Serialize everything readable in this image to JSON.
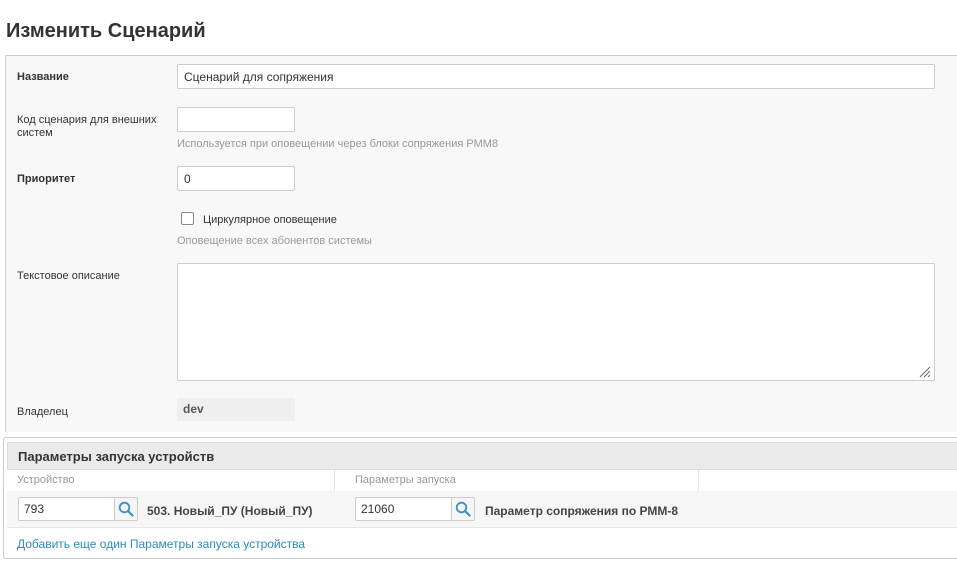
{
  "page_title": "Изменить Сценарий",
  "form": {
    "name": {
      "label": "Название",
      "value": "Сценарий для сопряжения"
    },
    "external_code": {
      "label": "Код сценария для внешних систем",
      "value": "",
      "help": "Используется при оповещении через блоки сопряжения РММ8"
    },
    "priority": {
      "label": "Приоритет",
      "value": "0"
    },
    "circular": {
      "checkbox_label": "Циркулярное оповещение",
      "checked": false,
      "help": "Оповещение всех абонентов системы"
    },
    "description": {
      "label": "Текстовое описание",
      "value": ""
    },
    "owner": {
      "label": "Владелец",
      "value": "dev"
    }
  },
  "device_params": {
    "title": "Параметры запуска устройств",
    "columns": [
      "Устройство",
      "Параметры запуска"
    ],
    "rows": [
      {
        "device_id": "793",
        "device_name": "503. Новый_ПУ (Новый_ПУ)",
        "param_id": "21060",
        "param_name": "Параметр сопряжения по РММ-8"
      }
    ],
    "add_link": "Добавить еще один Параметры запуска устройства"
  },
  "icons": {
    "lookup": "search-icon",
    "resize": "resize-grip-icon"
  },
  "colors": {
    "link": "#2a8bbd",
    "lookup_icon": "#3a8fc4"
  }
}
